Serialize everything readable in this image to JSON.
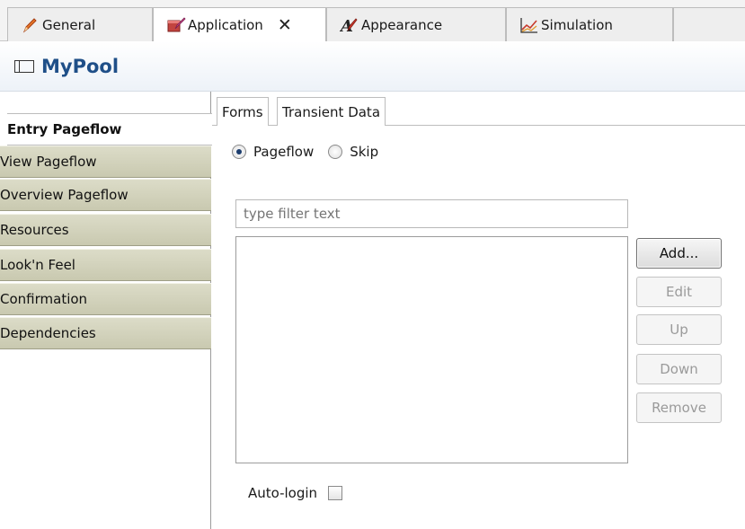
{
  "top_tabs": [
    {
      "label": "General",
      "icon": "pencil-icon",
      "active": false
    },
    {
      "label": "Application",
      "icon": "application-edit-icon",
      "active": true,
      "close": "✕"
    },
    {
      "label": "Appearance",
      "icon": "appearance-icon",
      "active": false
    },
    {
      "label": "Simulation",
      "icon": "simulation-chart-icon",
      "active": false
    }
  ],
  "title": "MyPool",
  "side_tabs": [
    {
      "label": "Entry Pageflow",
      "active": true
    },
    {
      "label": "View Pageflow"
    },
    {
      "label": "Overview Pageflow"
    },
    {
      "label": "Resources"
    },
    {
      "label": "Look'n Feel"
    },
    {
      "label": "Confirmation"
    },
    {
      "label": "Dependencies"
    }
  ],
  "inner_tabs": [
    {
      "label": "Forms",
      "active": true
    },
    {
      "label": "Transient Data"
    }
  ],
  "radios": {
    "pageflow": {
      "label": "Pageflow",
      "checked": true
    },
    "skip": {
      "label": "Skip",
      "checked": false
    }
  },
  "filter": {
    "placeholder": "type filter text",
    "value": ""
  },
  "buttons": {
    "add": "Add...",
    "edit": "Edit",
    "up": "Up",
    "down": "Down",
    "remove": "Remove"
  },
  "autologin": {
    "label": "Auto-login",
    "checked": false
  },
  "colors": {
    "title": "#1f4f88",
    "side_tab_bg": "#d2d2ba",
    "active_radio": "#1c3d6e"
  }
}
